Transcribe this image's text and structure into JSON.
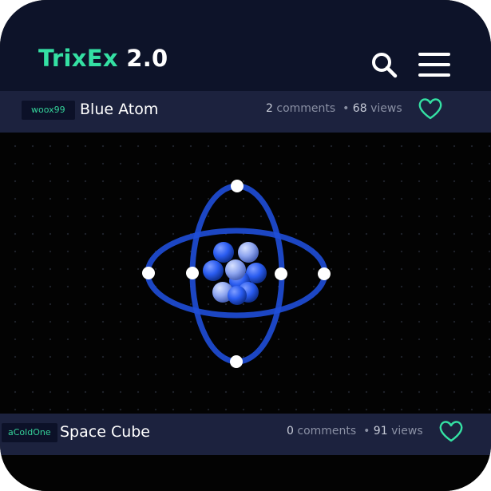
{
  "app": {
    "logo_primary": "TrixEx",
    "logo_secondary": "2.0"
  },
  "header": {
    "icons": [
      "search-icon",
      "menu-icon"
    ]
  },
  "posts": [
    {
      "user": "woox99",
      "title": "Blue Atom",
      "comments_count": "2",
      "comments_label": "comments",
      "views_count": "68",
      "views_label": "views",
      "like_icon": "heart-icon"
    },
    {
      "user": "aColdOne",
      "title": "Space Cube",
      "comments_count": "0",
      "comments_label": "comments",
      "views_count": "91",
      "views_label": "views",
      "like_icon": "heart-icon"
    }
  ],
  "colors": {
    "accent": "#34e0a3",
    "header_bg": "#0d1329",
    "bar_bg": "#1c223e",
    "atom_blue": "#2563eb"
  }
}
